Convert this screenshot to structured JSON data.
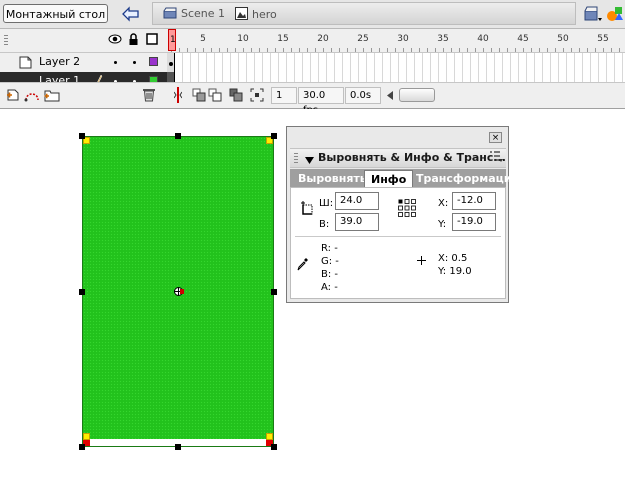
{
  "editbar": {
    "stage_button": "Монтажный стол",
    "crumbs": {
      "scene": "Scene 1",
      "symbol": "hero"
    }
  },
  "timeline": {
    "frame_numbers": [
      "5",
      "10",
      "15",
      "20",
      "25",
      "30",
      "35",
      "40",
      "45",
      "50",
      "55"
    ],
    "playhead_frame": "1",
    "layers": [
      {
        "name": "Layer 2",
        "color": "#9933cc",
        "selected": false
      },
      {
        "name": "Layer 1",
        "color": "#33cc33",
        "selected": true
      }
    ],
    "footer": {
      "current_frame": "1",
      "frame_rate": "30.0 fps",
      "elapsed": "0.0s"
    }
  },
  "stage": {
    "shape_color": "#22c21c"
  },
  "panel": {
    "title": "Выровнять & Инфо & Транс...",
    "tabs": [
      "Выровнять",
      "Инфо",
      "Трансформаци"
    ],
    "active_tab": "Инфо",
    "width_label": "Ш:",
    "width_value": "24.0",
    "height_label": "В:",
    "height_value": "39.0",
    "x_label": "X:",
    "x_value": "-12.0",
    "y_label": "Y:",
    "y_value": "-19.0",
    "color_r": "R: -",
    "color_g": "G: -",
    "color_b": "B: -",
    "color_a": "A: -",
    "cursor_x": "X:  0.5",
    "cursor_y": "Y:  19.0"
  }
}
